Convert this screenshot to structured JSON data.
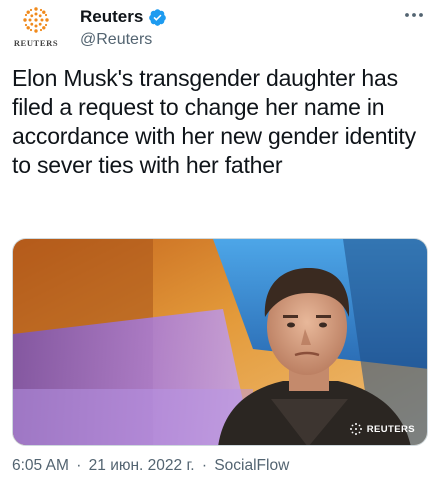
{
  "author": {
    "logo_label": "REUTERS",
    "display_name": "Reuters",
    "handle": "@Reuters",
    "verified": true,
    "verified_color": "#1d9bf0"
  },
  "tweet": {
    "text": "Elon Musk's transgender daughter has filed a request to change her name in accordance with her new gender identity to sever ties with her father"
  },
  "media": {
    "watermark": "REUTERS"
  },
  "meta": {
    "time": "6:05 AM",
    "separator": "·",
    "date": "21 июн. 2022 г.",
    "source": "SocialFlow"
  },
  "colors": {
    "logo_orange": "#f08a1c",
    "secondary_text": "#536471"
  },
  "icons": {
    "more": "more-horizontal-icon",
    "verified": "verified-badge-icon",
    "logo": "reuters-logo-icon"
  }
}
